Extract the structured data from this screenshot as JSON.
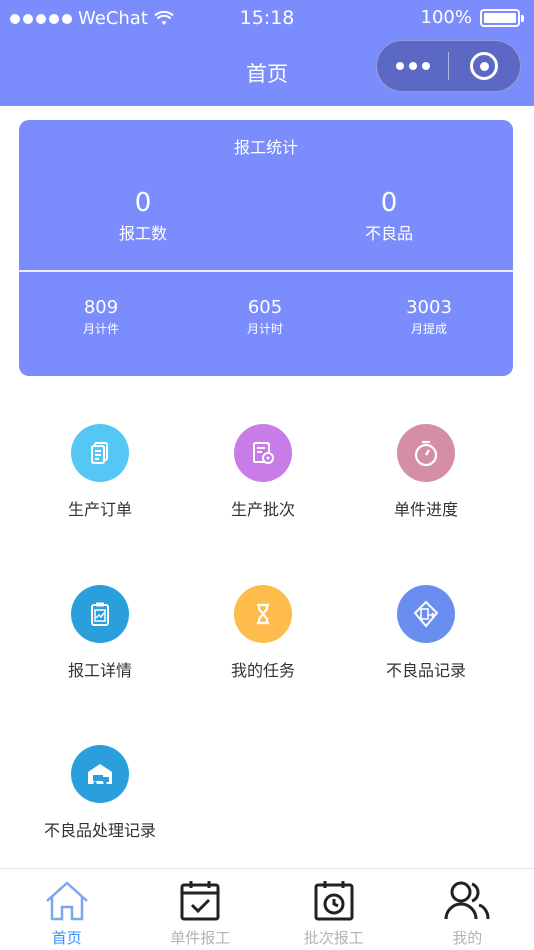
{
  "status_bar": {
    "carrier": "WeChat",
    "time": "15:18",
    "battery": "100%"
  },
  "nav": {
    "title": "首页"
  },
  "stats": {
    "title": "报工统计",
    "primary": [
      {
        "value": "0",
        "label": "报工数"
      },
      {
        "value": "0",
        "label": "不良品"
      }
    ],
    "secondary": [
      {
        "value": "809",
        "label": "月计件"
      },
      {
        "value": "605",
        "label": "月计时"
      },
      {
        "value": "3003",
        "label": "月提成"
      }
    ]
  },
  "grid": [
    {
      "label": "生产订单",
      "icon": "document-icon",
      "color": "#54c7f5"
    },
    {
      "label": "生产批次",
      "icon": "batch-icon",
      "color": "#c77ce8"
    },
    {
      "label": "单件进度",
      "icon": "stopwatch-icon",
      "color": "#d48fa6"
    },
    {
      "label": "报工详情",
      "icon": "clipboard-chart-icon",
      "color": "#2b9fdc"
    },
    {
      "label": "我的任务",
      "icon": "hourglass-icon",
      "color": "#fdbc4b"
    },
    {
      "label": "不良品记录",
      "icon": "building-arrow-icon",
      "color": "#6a8ef0"
    },
    {
      "label": "不良品处理记录",
      "icon": "warehouse-truck-icon",
      "color": "#2b9fdc"
    }
  ],
  "tabbar": [
    {
      "label": "首页",
      "icon": "home-icon",
      "active": true
    },
    {
      "label": "单件报工",
      "icon": "calendar-check-icon",
      "active": false
    },
    {
      "label": "批次报工",
      "icon": "calendar-clock-icon",
      "active": false
    },
    {
      "label": "我的",
      "icon": "users-icon",
      "active": false
    }
  ],
  "colors": {
    "primary": "#7b8dfc",
    "active_tab": "#3e8ef7",
    "inactive_tab": "#b3b3b3"
  }
}
